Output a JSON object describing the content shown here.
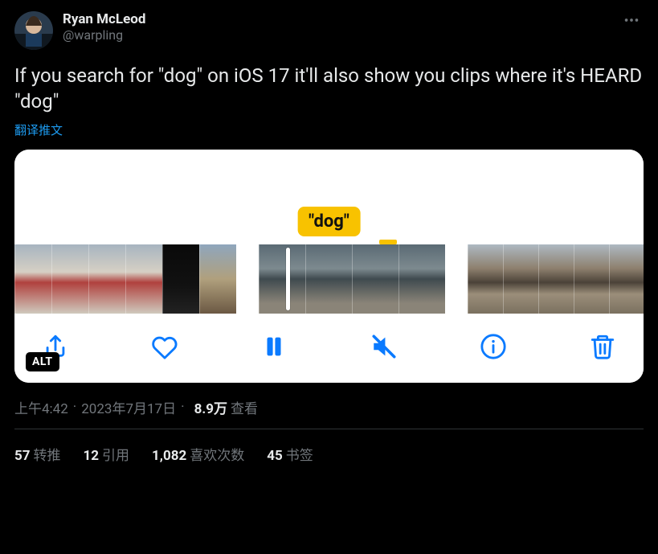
{
  "author": {
    "display_name": "Ryan McLeod",
    "handle": "@warpling"
  },
  "tweet_text": "If you search for \"dog\" on iOS 17 it'll also show you clips where it's HEARD \"dog\"",
  "translate_label": "翻译推文",
  "media": {
    "chip_label": "\"dog\"",
    "alt_badge": "ALT"
  },
  "meta": {
    "time": "上午4:42",
    "date": "2023年7月17日",
    "views_value": "8.9万",
    "views_label": "查看"
  },
  "stats": {
    "retweets": {
      "value": "57",
      "label": "转推"
    },
    "quotes": {
      "value": "12",
      "label": "引用"
    },
    "likes": {
      "value": "1,082",
      "label": "喜欢次数"
    },
    "bookmarks": {
      "value": "45",
      "label": "书签"
    }
  },
  "icons": {
    "more": "more-options",
    "share": "share",
    "heart": "heart",
    "pause": "pause",
    "mute": "mute",
    "info": "info",
    "trash": "trash"
  }
}
